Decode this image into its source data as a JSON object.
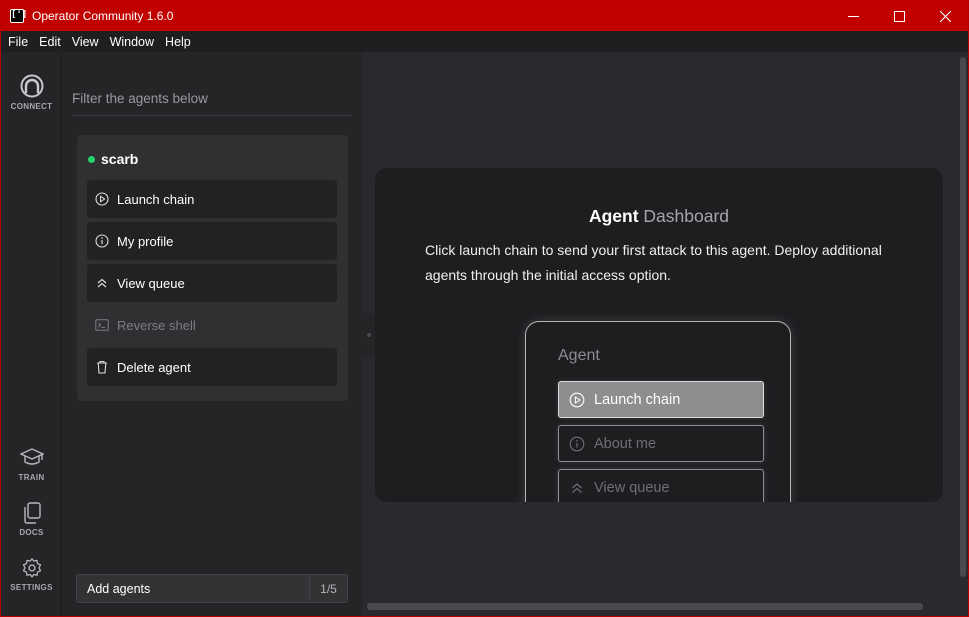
{
  "window": {
    "title": "Operator Community 1.6.0",
    "app_icon_text": "[']"
  },
  "menu": [
    "File",
    "Edit",
    "View",
    "Window",
    "Help"
  ],
  "rail": {
    "connect": "CONNECT",
    "train": "TRAIN",
    "docs": "DOCS",
    "settings": "SETTINGS"
  },
  "sidebar": {
    "filter_placeholder": "Filter the agents below",
    "agent": {
      "name": "scarb",
      "status_color": "#22d36a",
      "actions": [
        {
          "label": "Launch chain",
          "icon": "play-circle-icon",
          "enabled": true
        },
        {
          "label": "My profile",
          "icon": "info-circle-icon",
          "enabled": true
        },
        {
          "label": "View queue",
          "icon": "chevrons-up-icon",
          "enabled": true
        },
        {
          "label": "Reverse shell",
          "icon": "terminal-icon",
          "enabled": false
        },
        {
          "label": "Delete agent",
          "icon": "trash-icon",
          "enabled": true
        }
      ]
    },
    "add_agents": {
      "label": "Add agents",
      "count": "1/5"
    }
  },
  "dashboard": {
    "title_strong": "Agent",
    "title_muted": "Dashboard",
    "description": "Click launch chain to send your first attack to this agent. Deploy additional agents through the initial access option.",
    "mock": {
      "title": "Agent",
      "buttons": [
        {
          "label": "Launch chain",
          "icon": "play-circle-icon",
          "active": true
        },
        {
          "label": "About me",
          "icon": "info-circle-icon",
          "active": false
        },
        {
          "label": "View queue",
          "icon": "chevrons-up-icon",
          "active": false
        }
      ]
    }
  },
  "colors": {
    "titlebar": "#c10000",
    "accent_green": "#22d36a"
  }
}
